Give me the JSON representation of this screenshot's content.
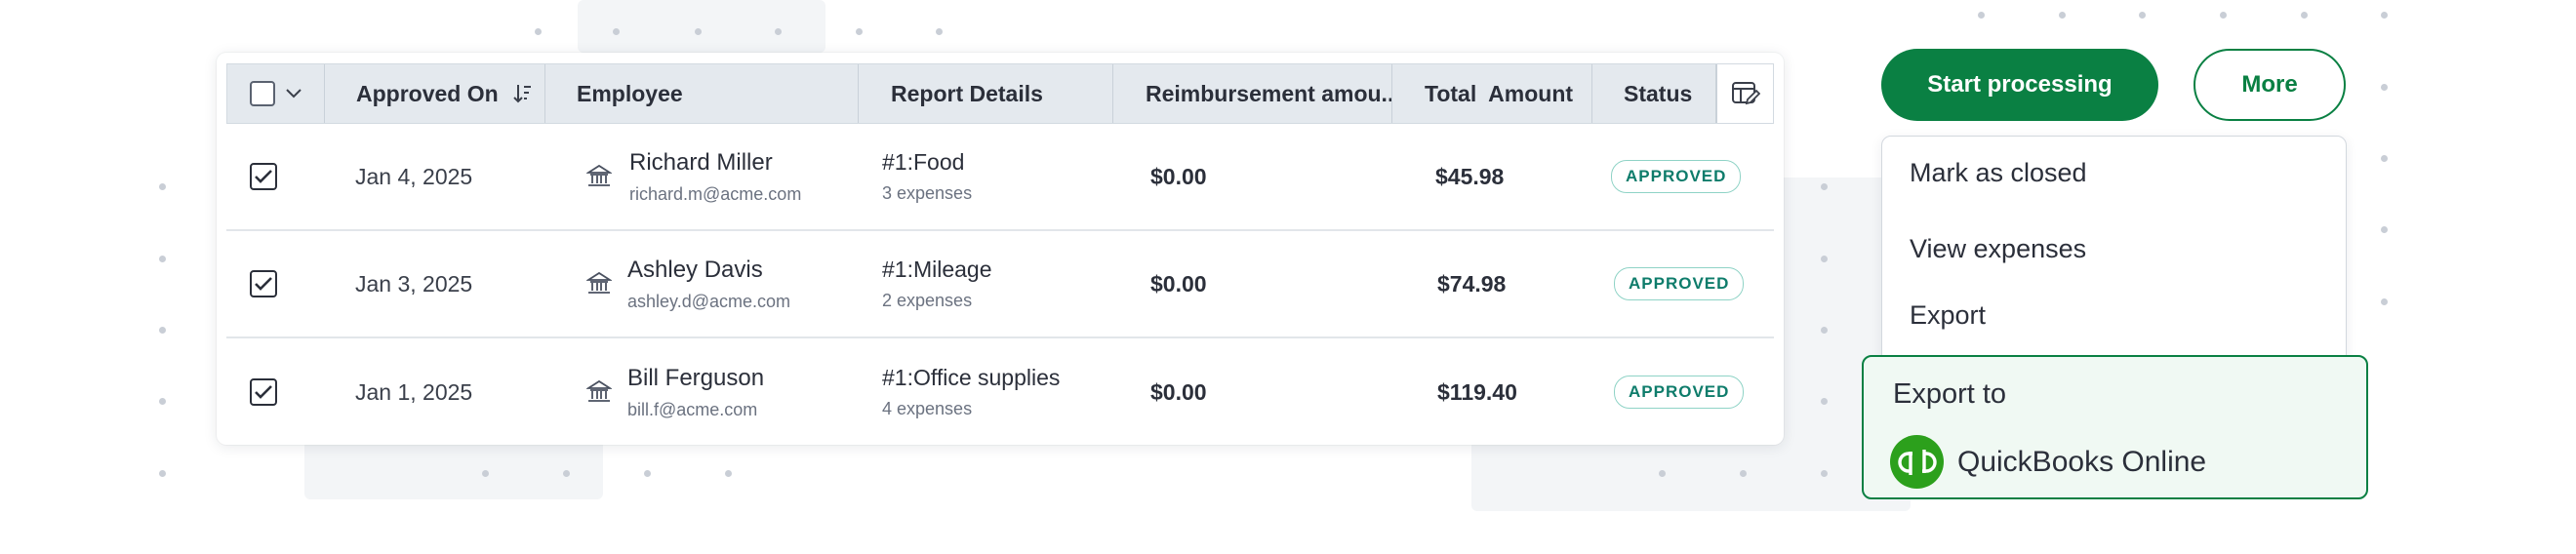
{
  "table": {
    "columns": {
      "approved_on": "Approved On",
      "employee": "Employee",
      "report_details": "Report Details",
      "reimbursement": "Reimbursement amou..",
      "total_amount": "Total  Amount",
      "status": "Status"
    },
    "rows": [
      {
        "selected": true,
        "date": "Jan 4, 2025",
        "employee_name": "Richard Miller",
        "employee_email": "richard.m@acme.com",
        "report_title": "#1:Food",
        "report_sub": "3 expenses",
        "reimbursement": "$0.00",
        "total": "$45.98",
        "status": "APPROVED"
      },
      {
        "selected": true,
        "date": "Jan 3, 2025",
        "employee_name": "Ashley Davis",
        "employee_email": "ashley.d@acme.com",
        "report_title": "#1:Mileage",
        "report_sub": "2 expenses",
        "reimbursement": "$0.00",
        "total": "$74.98",
        "status": "APPROVED"
      },
      {
        "selected": true,
        "date": "Jan 1, 2025",
        "employee_name": "Bill Ferguson",
        "employee_email": "bill.f@acme.com",
        "report_title": "#1:Office supplies",
        "report_sub": "4 expenses",
        "reimbursement": "$0.00",
        "total": "$119.40",
        "status": "APPROVED"
      }
    ]
  },
  "actions": {
    "start_processing": "Start processing",
    "more": "More"
  },
  "menu": {
    "items": [
      "Mark as closed",
      "View expenses",
      "Export"
    ]
  },
  "export_panel": {
    "title": "Export to",
    "target": "QuickBooks Online"
  },
  "icons": {
    "select_all": "checkbox-icon",
    "dropdown": "chevron-down-icon",
    "sort": "sort-descending-icon",
    "column_settings": "columns-settings-icon",
    "bank": "bank-icon",
    "checkmark": "check-icon",
    "quickbooks": "quickbooks-logo-icon"
  },
  "colors": {
    "brand_green": "#0a8043",
    "status_teal": "#0e7c6b",
    "quickbooks_green": "#2ca01c",
    "header_bg": "#e4e9ee"
  }
}
